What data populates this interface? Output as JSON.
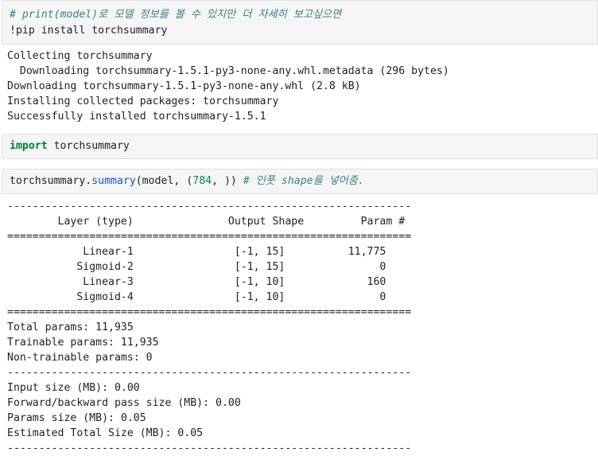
{
  "cells": {
    "c1": {
      "comment": "# print(model)로 모델 정보를 볼 수 있지만 더 자세히 보고싶으면",
      "code": "!pip install torchsummary",
      "output": [
        "Collecting torchsummary",
        "  Downloading torchsummary-1.5.1-py3-none-any.whl.metadata (296 bytes)",
        "Downloading torchsummary-1.5.1-py3-none-any.whl (2.8 kB)",
        "Installing collected packages: torchsummary",
        "Successfully installed torchsummary-1.5.1"
      ]
    },
    "c2": {
      "keyword": "import",
      "rest": " torchsummary"
    },
    "c3": {
      "obj": "torchsummary.",
      "fn": "summary",
      "args_a": "(model, (",
      "num": "784",
      "args_b": ", )) ",
      "comment": "# 인풋 shape를 넣어줌.",
      "output": [
        "----------------------------------------------------------------",
        "        Layer (type)               Output Shape         Param #",
        "================================================================",
        "            Linear-1                [-1, 15]          11,775",
        "           Sigmoid-2                [-1, 15]               0",
        "            Linear-3                [-1, 10]             160",
        "           Sigmoid-4                [-1, 10]               0",
        "================================================================",
        "Total params: 11,935",
        "Trainable params: 11,935",
        "Non-trainable params: 0",
        "----------------------------------------------------------------",
        "Input size (MB): 0.00",
        "Forward/backward pass size (MB): 0.00",
        "Params size (MB): 0.05",
        "Estimated Total Size (MB): 0.05",
        "----------------------------------------------------------------"
      ]
    }
  }
}
